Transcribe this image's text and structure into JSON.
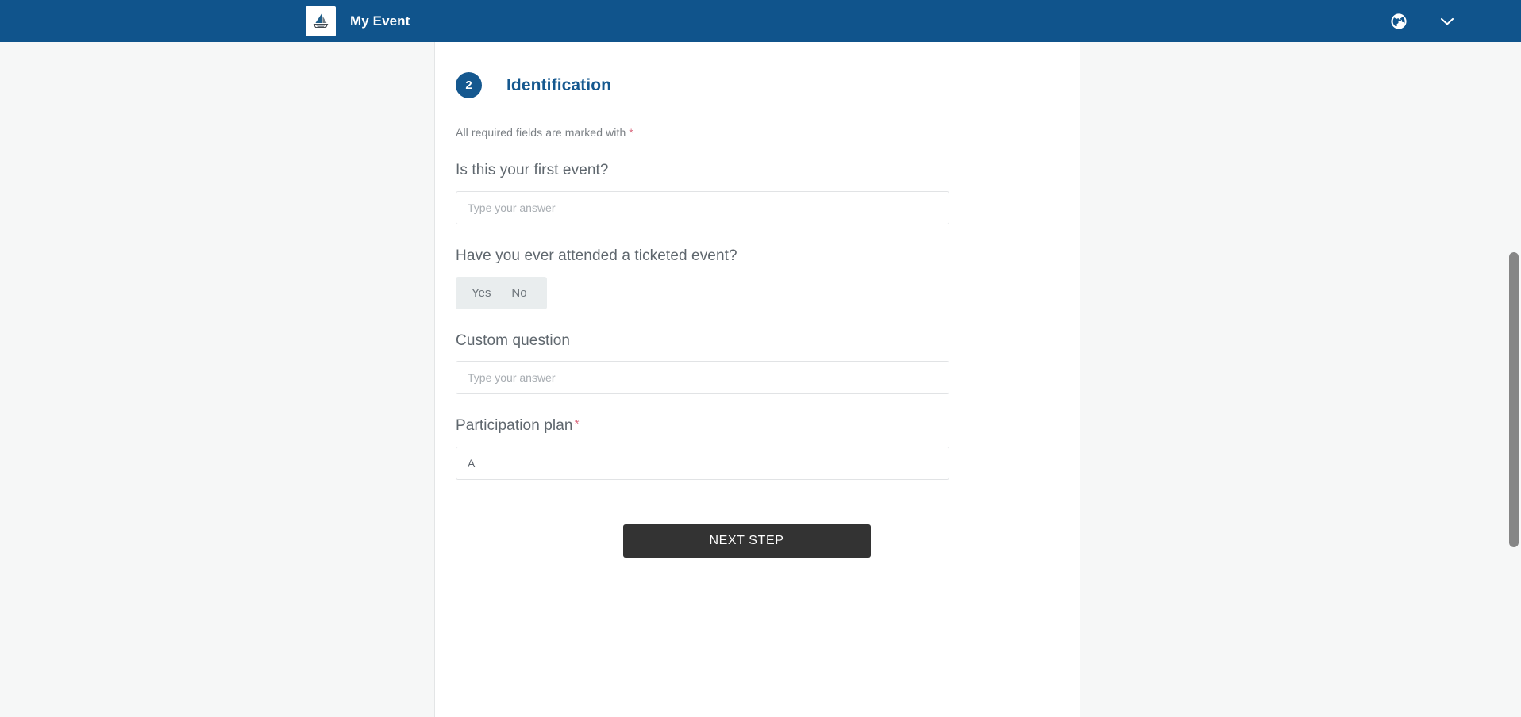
{
  "topbar": {
    "logo_icon": "sailboat-logo-icon",
    "brand_title": "My Event",
    "language_icon": "globe-icon",
    "account_menu_icon": "chevron-down-icon",
    "background_color": "#10548C"
  },
  "section": {
    "step_number": "2",
    "title": "Identification",
    "accent_color": "#15588F",
    "required_note_prefix": "All required fields are marked with",
    "required_marker": "*",
    "required_marker_color": "#D9697E"
  },
  "fields": [
    {
      "label": "Is this your first event?",
      "type": "text",
      "placeholder": "Type your answer",
      "value": "",
      "required": false
    },
    {
      "label": "Have you ever attended a ticketed event?",
      "type": "toggle",
      "options": [
        "Yes",
        "No"
      ],
      "selected": "",
      "required": false
    },
    {
      "label": "Custom question",
      "type": "text",
      "placeholder": "Type your answer",
      "value": "",
      "required": false
    },
    {
      "label": "Participation plan",
      "type": "text",
      "placeholder": "",
      "value": "A",
      "required": true,
      "required_marker": "*"
    }
  ],
  "actions": {
    "next_label": "NEXT STEP",
    "next_color": "#333333"
  },
  "scrollbar": {
    "orientation": "vertical",
    "thumb_color": "#868686"
  }
}
